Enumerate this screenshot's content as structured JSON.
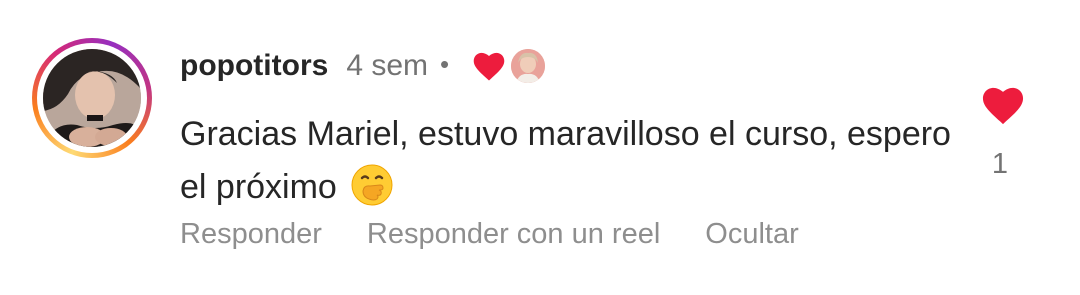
{
  "comment": {
    "username": "popotitors",
    "timestamp": "4 sem",
    "separator": "•",
    "text": "Gracias Mariel, estuvo maravilloso el curso, espero el próximo",
    "emoji": "hand-over-mouth-emoji",
    "creator_liked_icon": "heart-icon",
    "like_count": "1",
    "like_icon": "heart-icon",
    "liked": true,
    "colors": {
      "heart": "#ed1c3d",
      "ring": [
        "#feda75",
        "#fa7e1e",
        "#d62976",
        "#962fbf"
      ],
      "meta": "#8e8e8e"
    }
  },
  "actions": {
    "reply": "Responder",
    "reply_reel": "Responder con un reel",
    "hide": "Ocultar"
  }
}
